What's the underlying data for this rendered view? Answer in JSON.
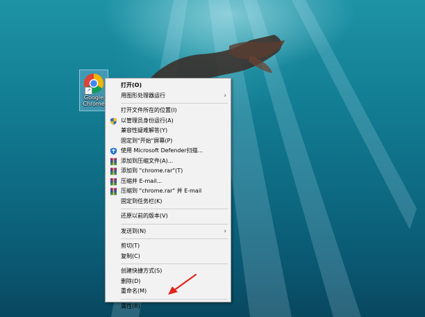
{
  "desktop": {
    "icon_label_line1": "Google",
    "icon_label_line2": "Chrome"
  },
  "context_menu": {
    "items": [
      {
        "label": "打开(O)"
      },
      {
        "label": "用图形处理器运行"
      },
      {
        "label": "打开文件所在的位置(I)"
      },
      {
        "label": "以管理员身份运行(A)"
      },
      {
        "label": "兼容性疑难解答(Y)"
      },
      {
        "label": "固定到\"开始\"屏幕(P)"
      },
      {
        "label": "使用 Microsoft Defender扫描..."
      },
      {
        "label": "添加到压缩文件(A)..."
      },
      {
        "label": "添加到 \"chrome.rar\"(T)"
      },
      {
        "label": "压缩并 E-mail..."
      },
      {
        "label": "压缩到 \"chrome.rar\" 并 E-mail"
      },
      {
        "label": "固定到任务栏(K)"
      },
      {
        "label": "还原以前的版本(V)"
      },
      {
        "label": "发送到(N)"
      },
      {
        "label": "剪切(T)"
      },
      {
        "label": "复制(C)"
      },
      {
        "label": "创建快捷方式(S)"
      },
      {
        "label": "删除(D)"
      },
      {
        "label": "重命名(M)"
      },
      {
        "label": "属性(R)"
      }
    ]
  },
  "colors": {
    "menu_bg": "#f2f2f2",
    "annotation_arrow": "#e0241b"
  },
  "icons": [
    "chrome-icon",
    "shortcut-arrow-icon",
    "uac-shield-icon",
    "defender-icon",
    "winrar-icon",
    "submenu-arrow-icon"
  ]
}
